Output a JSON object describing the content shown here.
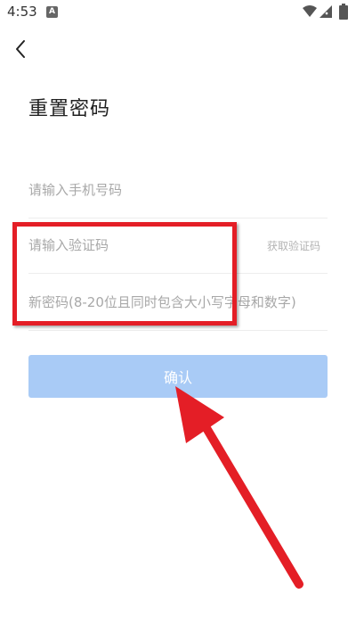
{
  "status_bar": {
    "time": "4:53",
    "notification_badge": "A"
  },
  "header": {
    "title": "重置密码"
  },
  "form": {
    "phone_placeholder": "请输入手机号码",
    "code_placeholder": "请输入验证码",
    "get_code_label": "获取验证码",
    "password_placeholder": "新密码(8-20位且同时包含大小写字母和数字)"
  },
  "confirm": {
    "label": "确认"
  },
  "colors": {
    "button_bg": "#a9cbf6",
    "annotation_red": "#e41e26"
  }
}
